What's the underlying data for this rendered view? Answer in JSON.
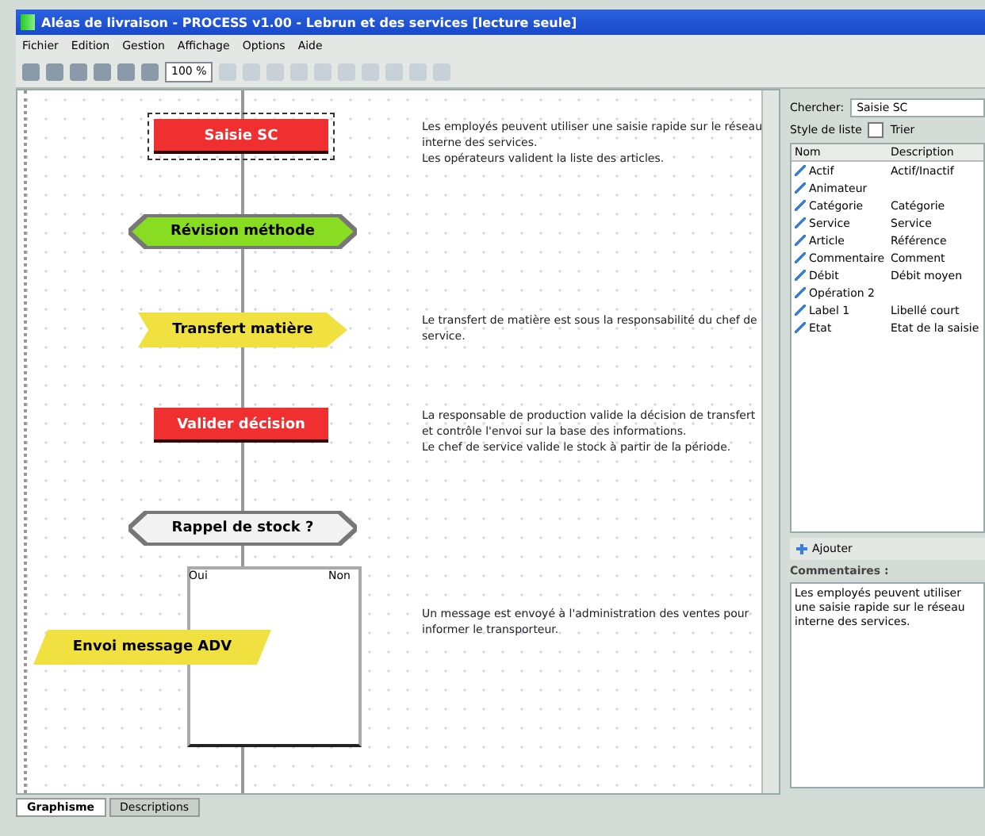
{
  "window": {
    "title": "Aléas de livraison - PROCESS v1.00 - Lebrun et des services [lecture seule]"
  },
  "menu": [
    "Fichier",
    "Edition",
    "Gestion",
    "Affichage",
    "Options",
    "Aide"
  ],
  "toolbar": {
    "zoom": "100 %"
  },
  "diagram": {
    "nodes": [
      {
        "kind": "rect",
        "label": "Saisie SC",
        "color": "#f03030",
        "selected": true,
        "description": "Les employés peuvent utiliser une saisie rapide sur le réseau interne des services.\nLes opérateurs valident la liste des articles."
      },
      {
        "kind": "hexagon",
        "label": "Révision méthode",
        "color": "#88dd22",
        "selected": false
      },
      {
        "kind": "arrow",
        "label": "Transfert matière",
        "color": "#f0e040",
        "selected": false,
        "description": "Le transfert de matière est sous la responsabilité du chef de service."
      },
      {
        "kind": "rect",
        "label": "Valider décision",
        "color": "#f03030",
        "selected": false,
        "description": "La responsable de production valide la décision de transfert et contrôle l'envoi sur la base des informations.\nLe chef de service valide le stock à partir de la période."
      },
      {
        "kind": "hexagon",
        "label": "Rappel de stock ?",
        "color": "#f2f2f2",
        "selected": false
      },
      {
        "kind": "parallelogram",
        "label": "Envoi message ADV",
        "color": "#f0e040",
        "selected": false,
        "description": "Un message est envoyé à l'administration des ventes pour informer le transporteur."
      }
    ],
    "branch": {
      "yes": "Oui",
      "no": "Non"
    }
  },
  "tabs": [
    {
      "label": "Graphisme",
      "selected": true
    },
    {
      "label": "Descriptions",
      "selected": false
    }
  ],
  "panel": {
    "search_label": "Chercher:",
    "search_value": "Saisie SC",
    "list_style": "Style de liste",
    "sort": {
      "label": "Trier",
      "checked": false
    },
    "columns": [
      "Nom",
      "Description"
    ],
    "rows": [
      {
        "name": "Actif",
        "description": "Actif/Inactif"
      },
      {
        "name": "Animateur"
      },
      {
        "name": "Catégorie",
        "description": "Catégorie"
      },
      {
        "name": "Service",
        "description": "Service"
      },
      {
        "name": "Article",
        "description": "Référence"
      },
      {
        "name": "Commentaire",
        "description": "Comment"
      },
      {
        "name": "Débit",
        "description": "Débit moyen"
      },
      {
        "name": "Opération 2"
      },
      {
        "name": "Label 1",
        "description": "Libellé court"
      },
      {
        "name": "Etat",
        "description": "Etat de la saisie"
      }
    ],
    "add_button": "Ajouter",
    "comments_label": "Commentaires :",
    "comments": "Les employés peuvent utiliser une saisie rapide sur le réseau interne des services."
  }
}
